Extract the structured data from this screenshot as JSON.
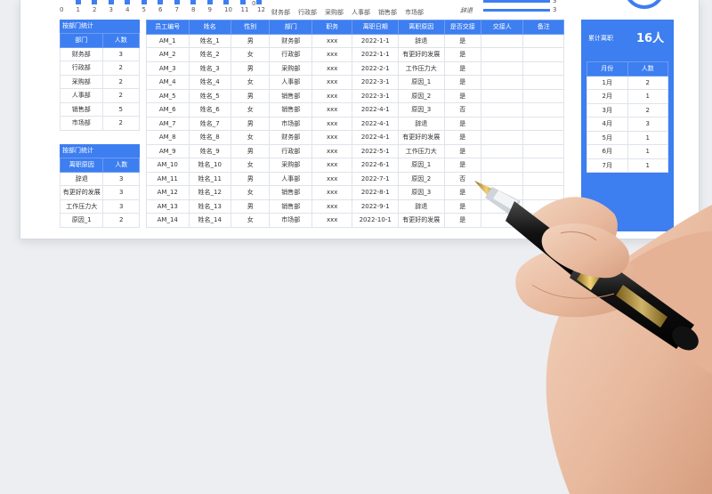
{
  "top_charts": {
    "bar_chart_axis": [
      "0",
      "1",
      "2",
      "3",
      "4",
      "5",
      "6",
      "7",
      "8",
      "9",
      "10",
      "11",
      "12"
    ],
    "bar_chart_zero_right": "0",
    "dept_axis": [
      "财务部",
      "行政部",
      "采购部",
      "人事部",
      "销售部",
      "市场部"
    ],
    "hbar_labels": [
      "辞退"
    ],
    "hbar_values": [
      "3",
      "3"
    ]
  },
  "dept_stats": {
    "title": "按部门统计",
    "headers": [
      "部门",
      "人数"
    ],
    "rows": [
      [
        "财务部",
        "3"
      ],
      [
        "行政部",
        "2"
      ],
      [
        "采购部",
        "2"
      ],
      [
        "人事部",
        "2"
      ],
      [
        "销售部",
        "5"
      ],
      [
        "市场部",
        "2"
      ]
    ]
  },
  "reason_stats": {
    "title": "按部门统计",
    "headers": [
      "离职原因",
      "人数"
    ],
    "rows": [
      [
        "辞退",
        "3"
      ],
      [
        "有更好的发展",
        "3"
      ],
      [
        "工作压力大",
        "3"
      ],
      [
        "原因_1",
        "2"
      ]
    ]
  },
  "main_table": {
    "headers": [
      "员工编号",
      "姓名",
      "性别",
      "部门",
      "职务",
      "离职日期",
      "离职原因",
      "是否交接",
      "交接人",
      "备注"
    ],
    "rows": [
      [
        "AM_1",
        "姓名_1",
        "男",
        "财务部",
        "xxx",
        "2022-1-1",
        "辞退",
        "是",
        "",
        ""
      ],
      [
        "AM_2",
        "姓名_2",
        "女",
        "行政部",
        "xxx",
        "2022-1-1",
        "有更好的发展",
        "是",
        "",
        ""
      ],
      [
        "AM_3",
        "姓名_3",
        "男",
        "采购部",
        "xxx",
        "2022-2-1",
        "工作压力大",
        "是",
        "",
        ""
      ],
      [
        "AM_4",
        "姓名_4",
        "女",
        "人事部",
        "xxx",
        "2022-3-1",
        "原因_1",
        "是",
        "",
        ""
      ],
      [
        "AM_5",
        "姓名_5",
        "男",
        "销售部",
        "xxx",
        "2022-3-1",
        "原因_2",
        "是",
        "",
        ""
      ],
      [
        "AM_6",
        "姓名_6",
        "女",
        "销售部",
        "xxx",
        "2022-4-1",
        "原因_3",
        "否",
        "",
        ""
      ],
      [
        "AM_7",
        "姓名_7",
        "男",
        "市场部",
        "xxx",
        "2022-4-1",
        "辞退",
        "是",
        "",
        ""
      ],
      [
        "AM_8",
        "姓名_8",
        "女",
        "财务部",
        "xxx",
        "2022-4-1",
        "有更好的发展",
        "是",
        "",
        ""
      ],
      [
        "AM_9",
        "姓名_9",
        "男",
        "行政部",
        "xxx",
        "2022-5-1",
        "工作压力大",
        "是",
        "",
        ""
      ],
      [
        "AM_10",
        "姓名_10",
        "女",
        "采购部",
        "xxx",
        "2022-6-1",
        "原因_1",
        "是",
        "",
        ""
      ],
      [
        "AM_11",
        "姓名_11",
        "男",
        "人事部",
        "xxx",
        "2022-7-1",
        "原因_2",
        "否",
        "",
        ""
      ],
      [
        "AM_12",
        "姓名_12",
        "女",
        "销售部",
        "xxx",
        "2022-8-1",
        "原因_3",
        "是",
        "",
        ""
      ],
      [
        "AM_13",
        "姓名_13",
        "男",
        "销售部",
        "xxx",
        "2022-9-1",
        "辞退",
        "是",
        "",
        ""
      ],
      [
        "AM_14",
        "姓名_14",
        "女",
        "市场部",
        "xxx",
        "2022-10-1",
        "有更好的发展",
        "是",
        "",
        ""
      ]
    ]
  },
  "summary": {
    "label": "累计离职",
    "value": "16人",
    "headers": [
      "月份",
      "人数"
    ],
    "rows": [
      [
        "1月",
        "2"
      ],
      [
        "2月",
        "1"
      ],
      [
        "3月",
        "2"
      ],
      [
        "4月",
        "3"
      ],
      [
        "5月",
        "1"
      ],
      [
        "6月",
        "1"
      ],
      [
        "7月",
        "1"
      ]
    ]
  },
  "colors": {
    "accent": "#3d7ef0",
    "grid": "#dfe3ea"
  }
}
